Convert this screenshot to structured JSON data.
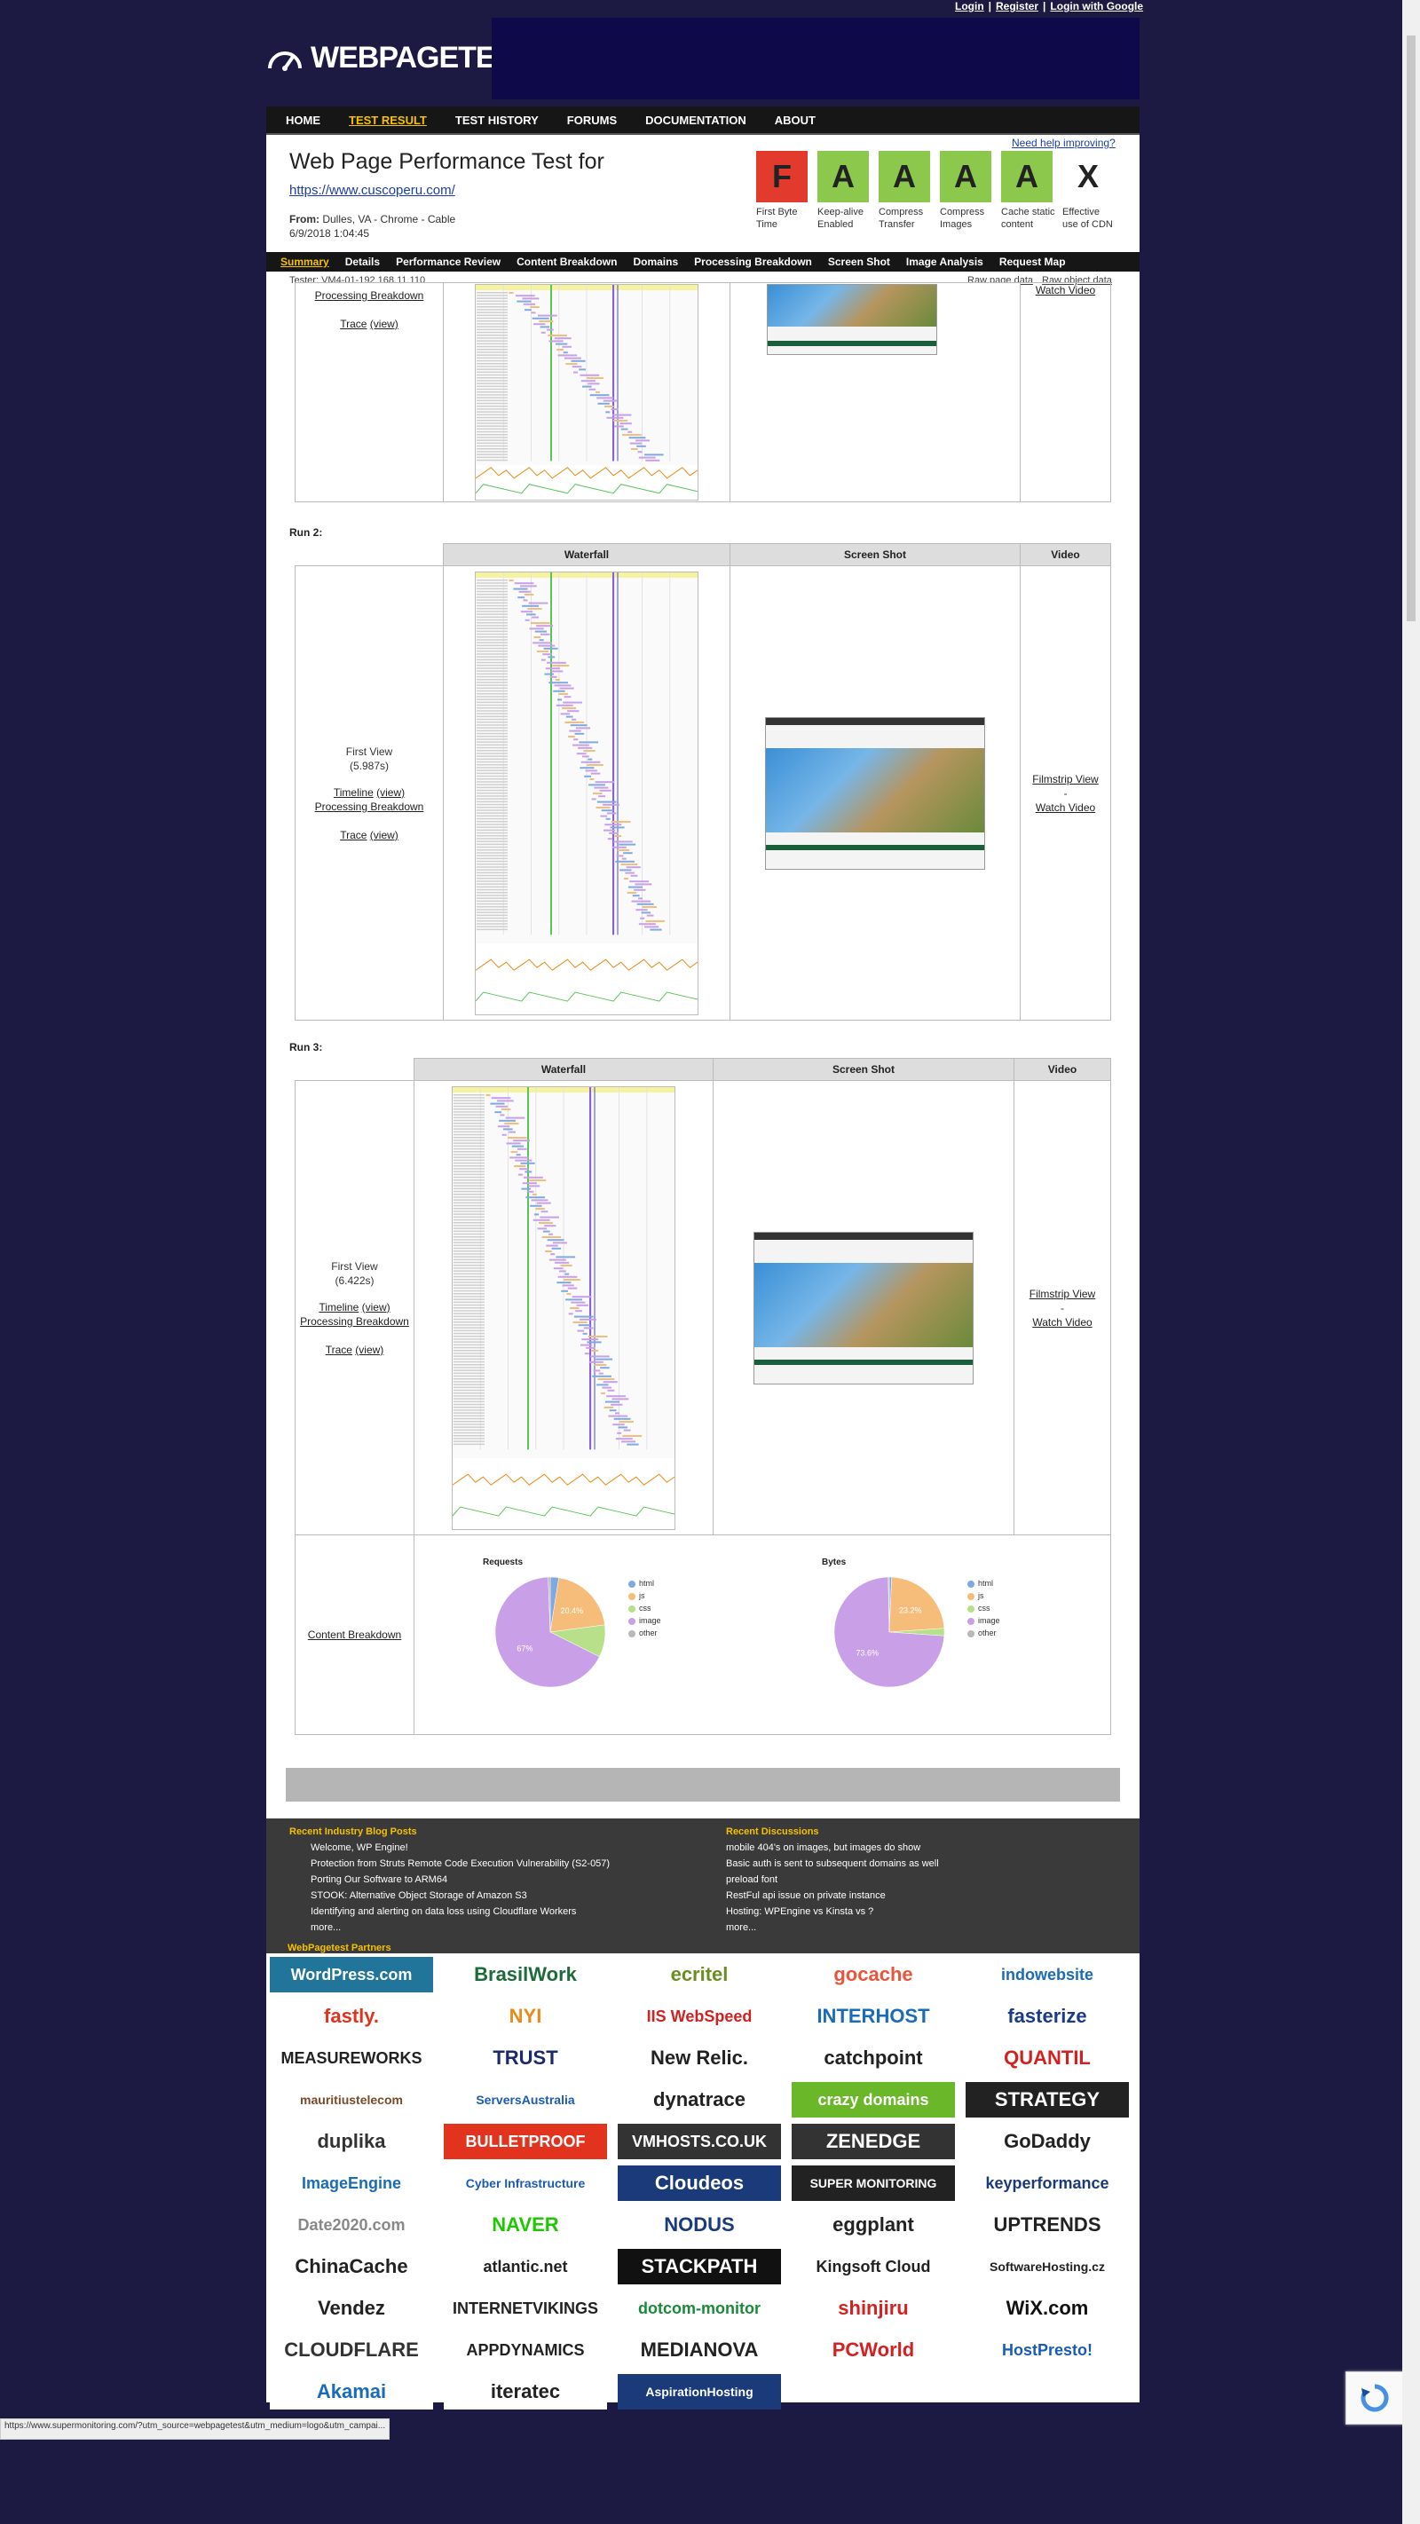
{
  "top_links": [
    "Login",
    "Register",
    "Login with Google"
  ],
  "brand": "WEBPAGETEST",
  "nav": [
    "HOME",
    "TEST RESULT",
    "TEST HISTORY",
    "FORUMS",
    "DOCUMENTATION",
    "ABOUT"
  ],
  "header": {
    "title": "Web Page Performance Test for",
    "url": "https://www.cuscoperu.com/",
    "from_label": "From:",
    "from_value": "Dulles, VA - Chrome - Cable",
    "date": "6/9/2018 1:04:45",
    "need_help": "Need help improving?"
  },
  "grades": [
    {
      "grade": "F",
      "label": "First Byte Time",
      "color": "#e23b2e"
    },
    {
      "grade": "A",
      "label": "Keep-alive Enabled",
      "color": "#8cc84b"
    },
    {
      "grade": "A",
      "label": "Compress Transfer",
      "color": "#8cc84b"
    },
    {
      "grade": "A",
      "label": "Compress Images",
      "color": "#8cc84b"
    },
    {
      "grade": "A",
      "label": "Cache static content",
      "color": "#8cc84b"
    },
    {
      "grade": "X",
      "label": "Effective use of CDN",
      "color": "#ffffff"
    }
  ],
  "subnav": [
    "Summary",
    "Details",
    "Performance Review",
    "Content Breakdown",
    "Domains",
    "Processing Breakdown",
    "Screen Shot",
    "Image Analysis",
    "Request Map"
  ],
  "tester": "Tester: VM4-01-192.168.11.110",
  "raw": [
    "Raw page data",
    "Raw object data"
  ],
  "run1": {
    "processing": "Processing Breakdown",
    "trace": "Trace",
    "view": "(view)",
    "watch": "Watch Video"
  },
  "table_headers": {
    "waterfall": "Waterfall",
    "screenshot": "Screen Shot",
    "video": "Video"
  },
  "run2": {
    "label": "Run 2:",
    "first_view": "First View",
    "time": "(5.987s)",
    "timeline": "Timeline",
    "view": "(view)",
    "processing": "Processing Breakdown",
    "trace": "Trace",
    "filmstrip": "Filmstrip View",
    "dash": "-",
    "watch": "Watch Video"
  },
  "run3": {
    "label": "Run 3:",
    "first_view": "First View",
    "time": "(6.422s)",
    "timeline": "Timeline",
    "view": "(view)",
    "processing": "Processing Breakdown",
    "trace": "Trace",
    "filmstrip": "Filmstrip View",
    "dash": "-",
    "watch": "Watch Video"
  },
  "breakdown": {
    "link": "Content Breakdown",
    "requests_title": "Requests",
    "bytes_title": "Bytes",
    "legend": [
      "html",
      "js",
      "css",
      "image",
      "other"
    ],
    "legend_colors": [
      "#7fa9e0",
      "#f6bd7a",
      "#b8e08a",
      "#c9a0e8",
      "#b9b9b9"
    ],
    "requests_values": [
      2.5,
      20.4,
      9.5,
      67,
      0.6
    ],
    "requests_labels": [
      "20.4%",
      "67%"
    ],
    "bytes_values": [
      0.7,
      23.2,
      2.2,
      73.6,
      0.3
    ],
    "bytes_labels": [
      "23.2%",
      "73.6%"
    ]
  },
  "blog": {
    "title": "Recent Industry Blog Posts",
    "items": [
      "Welcome, WP Engine!",
      "Protection from Struts Remote Code Execution Vulnerability (S2-057)",
      "Porting Our Software to ARM64",
      "STOOK: Alternative Object Storage of Amazon S3",
      "Identifying and alerting on data loss using Cloudflare Workers",
      "more..."
    ]
  },
  "discussions": {
    "title": "Recent Discussions",
    "items": [
      "mobile 404's on images, but images do show",
      "Basic auth is sent to subsequent domains as well",
      "preload font",
      "RestFul api issue on private instance",
      "Hosting: WPEngine vs Kinsta vs ?",
      "more..."
    ]
  },
  "partners_title": "WebPagetest Partners",
  "partners": [
    {
      "name": "WordPress.com",
      "color": "#ffffff",
      "bg": "#21759b"
    },
    {
      "name": "BrasilWork",
      "color": "#1e6b3a",
      "bg": "#ffffff"
    },
    {
      "name": "ecritel",
      "color": "#6b8e23",
      "bg": "#ffffff"
    },
    {
      "name": "gocache",
      "color": "#e9553b",
      "bg": "#ffffff"
    },
    {
      "name": "indowebsite",
      "color": "#1a6bb8",
      "bg": "#ffffff"
    },
    {
      "name": "fastly.",
      "color": "#e2331e",
      "bg": "#ffffff"
    },
    {
      "name": "NYI",
      "color": "#e98b1a",
      "bg": "#ffffff"
    },
    {
      "name": "IIS WebSpeed",
      "color": "#d32020",
      "bg": "#ffffff"
    },
    {
      "name": "INTERHOST",
      "color": "#1a6bb8",
      "bg": "#ffffff"
    },
    {
      "name": "fasterize",
      "color": "#1a3a8a",
      "bg": "#ffffff"
    },
    {
      "name": "MEASUREWORKS",
      "color": "#222222",
      "bg": "#ffffff"
    },
    {
      "name": "TRUST",
      "color": "#1a2a6a",
      "bg": "#ffffff"
    },
    {
      "name": "New Relic.",
      "color": "#222222",
      "bg": "#ffffff"
    },
    {
      "name": "catchpoint",
      "color": "#222222",
      "bg": "#ffffff"
    },
    {
      "name": "QUANTIL",
      "color": "#d32020",
      "bg": "#ffffff"
    },
    {
      "name": "mauritiustelecom",
      "color": "#7a4a2a",
      "bg": "#ffffff"
    },
    {
      "name": "ServersAustralia",
      "color": "#1a5bb8",
      "bg": "#ffffff"
    },
    {
      "name": "dynatrace",
      "color": "#222222",
      "bg": "#ffffff"
    },
    {
      "name": "crazy domains",
      "color": "#ffffff",
      "bg": "#6ab82a"
    },
    {
      "name": "STRATEGY",
      "color": "#ffffff",
      "bg": "#222222"
    },
    {
      "name": "duplika",
      "color": "#333333",
      "bg": "#ffffff"
    },
    {
      "name": "BULLETPROOF",
      "color": "#ffffff",
      "bg": "#e2331e"
    },
    {
      "name": "VMHOSTS.CO.UK",
      "color": "#ffffff",
      "bg": "#333333"
    },
    {
      "name": "ZENEDGE",
      "color": "#ffffff",
      "bg": "#333333"
    },
    {
      "name": "GoDaddy",
      "color": "#222222",
      "bg": "#ffffff"
    },
    {
      "name": "ImageEngine",
      "color": "#1a6bb8",
      "bg": "#ffffff"
    },
    {
      "name": "Cyber Infrastructure",
      "color": "#1a5bb8",
      "bg": "#ffffff"
    },
    {
      "name": "Cloudeos",
      "color": "#ffffff",
      "bg": "#1a3a7a"
    },
    {
      "name": "SUPER MONITORING",
      "color": "#ffffff",
      "bg": "#222222"
    },
    {
      "name": "keyperformance",
      "color": "#1a3a7a",
      "bg": "#ffffff"
    },
    {
      "name": "Date2020.com",
      "color": "#888888",
      "bg": "#ffffff"
    },
    {
      "name": "NAVER",
      "color": "#1ec800",
      "bg": "#ffffff"
    },
    {
      "name": "NODUS",
      "color": "#1a3a7a",
      "bg": "#ffffff"
    },
    {
      "name": "eggplant",
      "color": "#222222",
      "bg": "#ffffff"
    },
    {
      "name": "UPTRENDS",
      "color": "#222222",
      "bg": "#ffffff"
    },
    {
      "name": "ChinaCache",
      "color": "#222222",
      "bg": "#ffffff"
    },
    {
      "name": "atlantic.net",
      "color": "#222222",
      "bg": "#ffffff"
    },
    {
      "name": "STACKPATH",
      "color": "#ffffff",
      "bg": "#111111"
    },
    {
      "name": "Kingsoft Cloud",
      "color": "#222222",
      "bg": "#ffffff"
    },
    {
      "name": "SoftwareHosting.cz",
      "color": "#222222",
      "bg": "#ffffff"
    },
    {
      "name": "Vendez",
      "color": "#222222",
      "bg": "#ffffff"
    },
    {
      "name": "INTERNETVIKINGS",
      "color": "#222222",
      "bg": "#ffffff"
    },
    {
      "name": "dotcom-monitor",
      "color": "#1a8a3a",
      "bg": "#ffffff"
    },
    {
      "name": "shinjiru",
      "color": "#d32020",
      "bg": "#ffffff"
    },
    {
      "name": "WiX.com",
      "color": "#111111",
      "bg": "#ffffff"
    },
    {
      "name": "CLOUDFLARE",
      "color": "#333333",
      "bg": "#ffffff"
    },
    {
      "name": "APPDYNAMICS",
      "color": "#222222",
      "bg": "#ffffff"
    },
    {
      "name": "MEDIANOVA",
      "color": "#222222",
      "bg": "#ffffff"
    },
    {
      "name": "PCWorld",
      "color": "#d32020",
      "bg": "#ffffff"
    },
    {
      "name": "HostPresto!",
      "color": "#1a5bb8",
      "bg": "#ffffff"
    },
    {
      "name": "Akamai",
      "color": "#1a6bb8",
      "bg": "#ffffff"
    },
    {
      "name": "iteratec",
      "color": "#222222",
      "bg": "#ffffff"
    },
    {
      "name": "AspirationHosting",
      "color": "#ffffff",
      "bg": "#1a3a7a"
    }
  ],
  "status_url": "https://www.supermonitoring.com/?utm_source=webpagetest&utm_medium=logo&utm_campai..."
}
